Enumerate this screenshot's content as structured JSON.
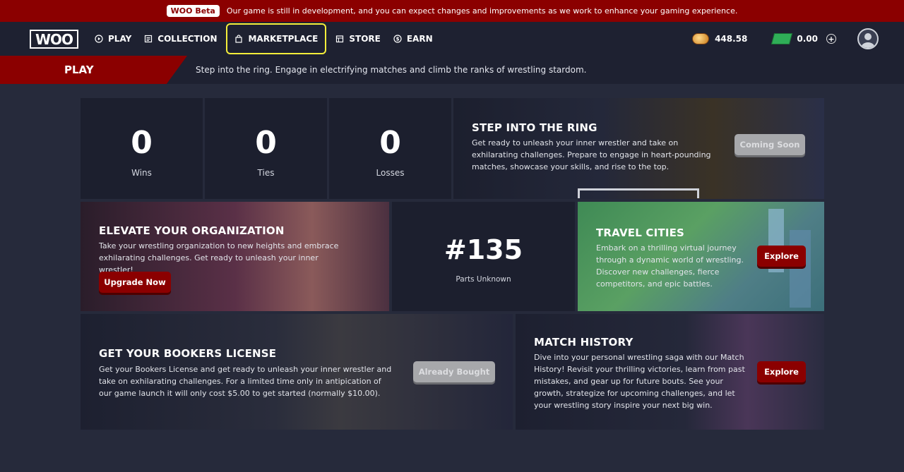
{
  "banner": {
    "badge": "WOO Beta",
    "text": "Our game is still in development, and you can expect changes and improvements as we work to enhance your gaming experience."
  },
  "nav": {
    "logo": "WOO",
    "items": [
      {
        "label": "PLAY",
        "icon": "play-circle-icon"
      },
      {
        "label": "COLLECTION",
        "icon": "collection-icon"
      },
      {
        "label": "MARKETPLACE",
        "icon": "shopping-bag-icon"
      },
      {
        "label": "STORE",
        "icon": "store-icon"
      },
      {
        "label": "EARN",
        "icon": "dollar-circle-icon"
      }
    ],
    "coins": "448.58",
    "cash": "0.00"
  },
  "playbar": {
    "title": "PLAY",
    "description": "Step into the ring. Engage in electrifying matches and climb the ranks of wrestling stardom."
  },
  "stats": [
    {
      "value": "0",
      "label": "Wins"
    },
    {
      "value": "0",
      "label": "Ties"
    },
    {
      "value": "0",
      "label": "Losses"
    }
  ],
  "ring": {
    "title": "STEP INTO THE RING",
    "text": "Get ready to unleash your inner wrestler and take on exhilarating challenges. Prepare to engage in heart-pounding matches, showcase your skills, and rise to the top.",
    "button": "Coming Soon"
  },
  "organization": {
    "title": "ELEVATE YOUR ORGANIZATION",
    "text": "Take your wrestling organization to new heights and embrace exhilarating challenges. Get ready to unleash your inner wrestler!",
    "button": "Upgrade Now"
  },
  "rank": {
    "value": "#135",
    "location": "Parts Unknown"
  },
  "travel": {
    "title": "TRAVEL CITIES",
    "text": "Embark on a thrilling virtual journey through a dynamic world of wrestling. Discover new challenges, fierce competitors, and epic battles.",
    "button": "Explore"
  },
  "bookers": {
    "title": "GET YOUR BOOKERS LICENSE",
    "text": "Get your Bookers License and get ready to unleash your inner wrestler and take on exhilarating challenges. For a limited time only in antipication of our game launch it will only cost $5.00 to get started (normally $10.00).",
    "button": "Already Bought"
  },
  "history": {
    "title": "MATCH HISTORY",
    "text": "Dive into your personal wrestling saga with our Match History! Revisit your thrilling victories, learn from past mistakes, and gear up for future bouts. See your growth, strategize for upcoming challenges, and let your wrestling story inspire your next big win.",
    "button": "Explore"
  },
  "colors": {
    "accent_red": "#8b0000",
    "highlight_yellow": "#f4ee3a",
    "background": "#262a3b",
    "card": "#1c1f2e"
  }
}
